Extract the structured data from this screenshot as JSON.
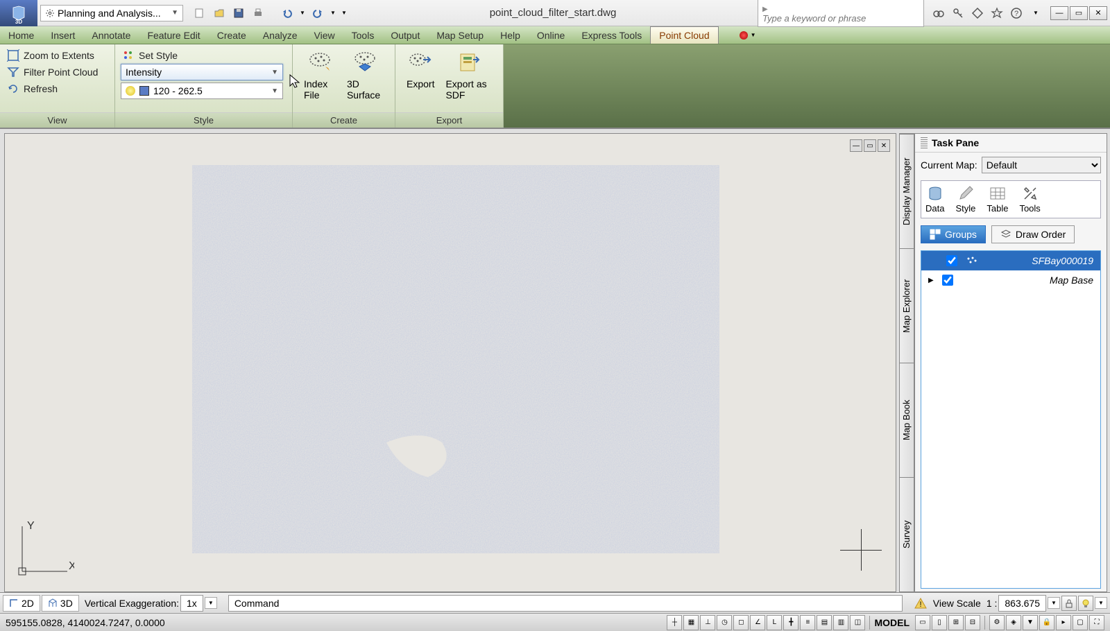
{
  "title": "point_cloud_filter_start.dwg",
  "workspace": "Planning and Analysis...",
  "search_placeholder": "Type a keyword or phrase",
  "menus": [
    "Home",
    "Insert",
    "Annotate",
    "Feature Edit",
    "Create",
    "Analyze",
    "View",
    "Tools",
    "Output",
    "Map Setup",
    "Help",
    "Online",
    "Express Tools",
    "Point Cloud"
  ],
  "active_menu": "Point Cloud",
  "ribbon": {
    "view": {
      "title": "View",
      "zoom": "Zoom to Extents",
      "filter": "Filter Point Cloud",
      "refresh": "Refresh"
    },
    "style": {
      "title": "Style",
      "set_style": "Set Style",
      "style_value": "Intensity",
      "filter_value": "120 - 262.5"
    },
    "create": {
      "title": "Create",
      "index": "Index File",
      "surface": "3D Surface"
    },
    "export": {
      "title": "Export",
      "export": "Export",
      "export_sdf": "Export as SDF"
    }
  },
  "task_pane": {
    "title": "Task Pane",
    "side_tabs": [
      "Display Manager",
      "Map Explorer",
      "Map Book",
      "Survey"
    ],
    "current_map_label": "Current Map:",
    "current_map_value": "Default",
    "tools": [
      "Data",
      "Style",
      "Table",
      "Tools"
    ],
    "tabs": {
      "groups": "Groups",
      "draw_order": "Draw Order"
    },
    "layers": [
      {
        "name": "SFBay000019",
        "selected": true
      },
      {
        "name": "Map Base",
        "selected": false
      }
    ]
  },
  "status": {
    "mode_2d": "2D",
    "mode_3d": "3D",
    "vexag_label": "Vertical Exaggeration:",
    "vexag_value": "1x",
    "command_label": "Command",
    "view_scale_label": "View Scale",
    "view_scale_ratio": "1 :",
    "view_scale_value": "863.675",
    "coords": "595155.0828, 4140024.7247, 0.0000",
    "model": "MODEL"
  }
}
